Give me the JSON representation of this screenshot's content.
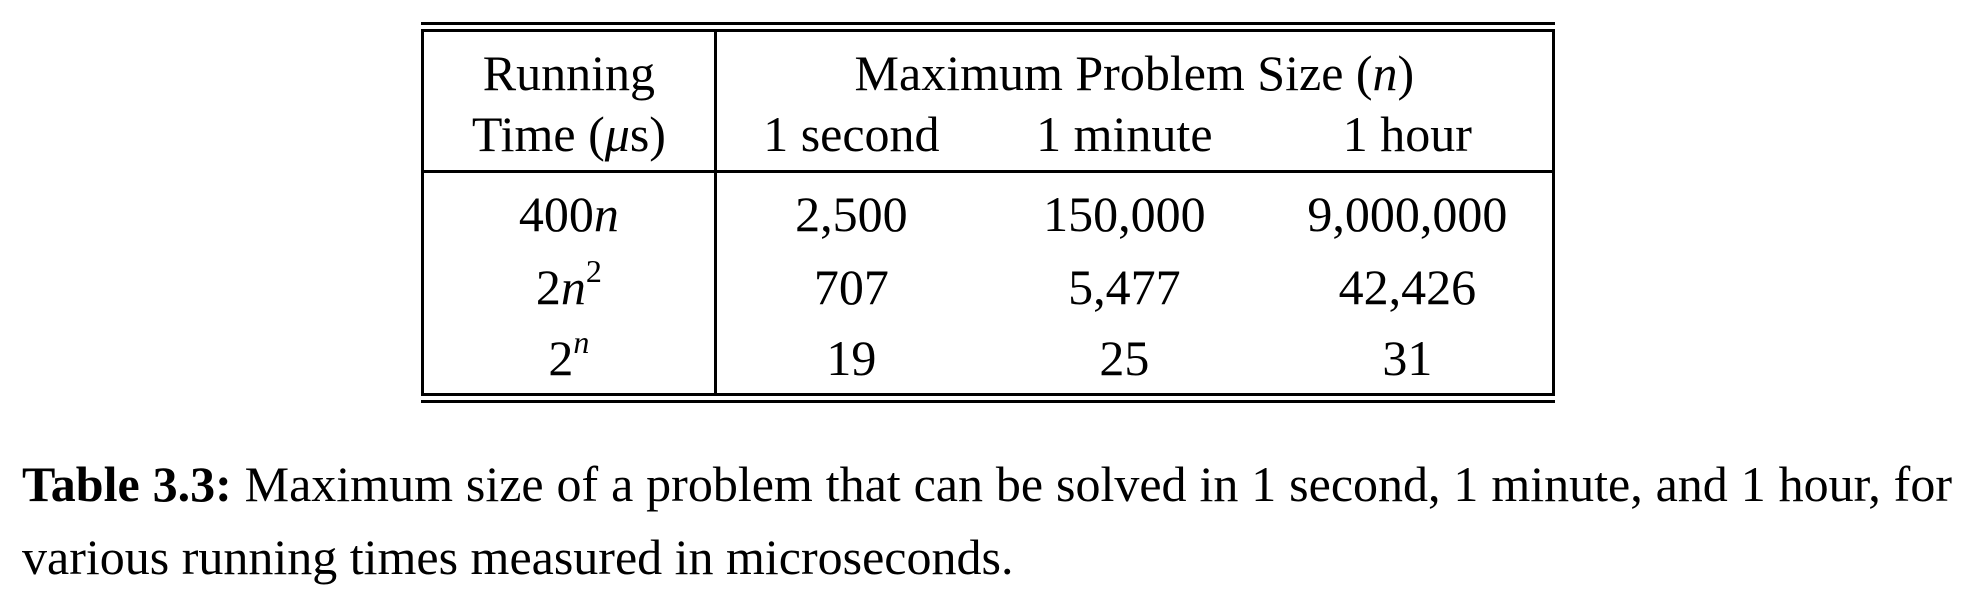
{
  "table": {
    "header": {
      "running_time_line1": "Running",
      "running_time_line2_prefix": "Time (",
      "running_time_mu": "μ",
      "running_time_line2_suffix": "s)",
      "max_size_prefix": "Maximum Problem Size (",
      "max_size_var": "n",
      "max_size_suffix": ")",
      "columns": [
        "1 second",
        "1 minute",
        "1 hour"
      ]
    },
    "rows": [
      {
        "coef": "400",
        "var": "n",
        "exp": "",
        "values": [
          "2,500",
          "150,000",
          "9,000,000"
        ]
      },
      {
        "coef": "2",
        "var": "n",
        "exp": "2",
        "values": [
          "707",
          "5,477",
          "42,426"
        ]
      },
      {
        "coef": "2",
        "var": "",
        "exp": "n",
        "values": [
          "19",
          "25",
          "31"
        ]
      }
    ]
  },
  "caption": {
    "label": "Table 3.3:",
    "text": " Maximum size of a problem that can be solved in 1 second, 1 minute, and 1 hour, for various running times measured in microseconds."
  }
}
